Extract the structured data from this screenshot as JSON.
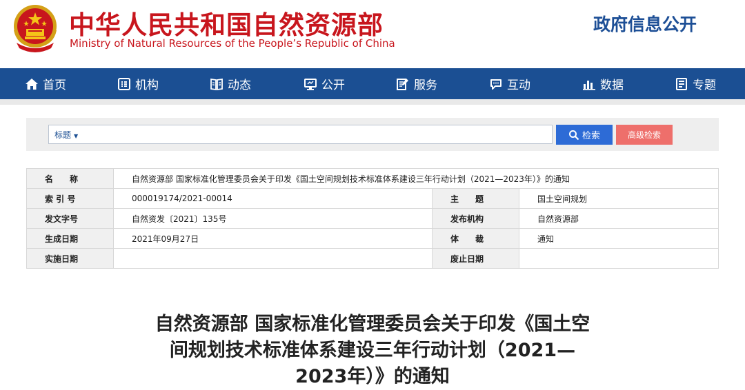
{
  "header": {
    "title_cn": "中华人民共和国自然资源部",
    "title_en": "Ministry of Natural Resources of the People’s Republic of China",
    "gov_info": "政府信息公开",
    "colors": {
      "brand_red": "#c8161d",
      "brand_blue": "#1d4f96"
    }
  },
  "nav": {
    "items": [
      {
        "label": "首页",
        "icon": "home-icon"
      },
      {
        "label": "机构",
        "icon": "org-icon"
      },
      {
        "label": "动态",
        "icon": "news-icon"
      },
      {
        "label": "公开",
        "icon": "monitor-icon"
      },
      {
        "label": "服务",
        "icon": "edit-icon"
      },
      {
        "label": "互动",
        "icon": "chat-icon"
      },
      {
        "label": "数据",
        "icon": "bar-chart-icon"
      },
      {
        "label": "专题",
        "icon": "topic-icon"
      }
    ],
    "color": "#1b4f93"
  },
  "search": {
    "select_value": "标题",
    "input_value": "",
    "search_label": "检索",
    "advanced_label": "高级检索"
  },
  "info": {
    "name_label": "名　　称",
    "name_value": "自然资源部 国家标准化管理委员会关于印发《国土空间规划技术标准体系建设三年行动计划（2021—2023年）》的通知",
    "index_label": "索 引 号",
    "index_value": "000019174/2021-00014",
    "subject_label": "主　　题",
    "subject_value": "国土空间规划",
    "docno_label": "发文字号",
    "docno_value": "自然资发〔2021〕135号",
    "issuer_label": "发布机构",
    "issuer_value": "自然资源部",
    "date_label": "生成日期",
    "date_value": "2021年09月27日",
    "genre_label": "体　　裁",
    "genre_value": "通知",
    "effective_label": "实施日期",
    "effective_value": "",
    "expiry_label": "废止日期",
    "expiry_value": ""
  },
  "doc": {
    "title_line1": "自然资源部 国家标准化管理委员会关于印发《国土空",
    "title_line2": "间规划技术标准体系建设三年行动计划（2021—",
    "title_line3": "2023年）》的通知"
  }
}
